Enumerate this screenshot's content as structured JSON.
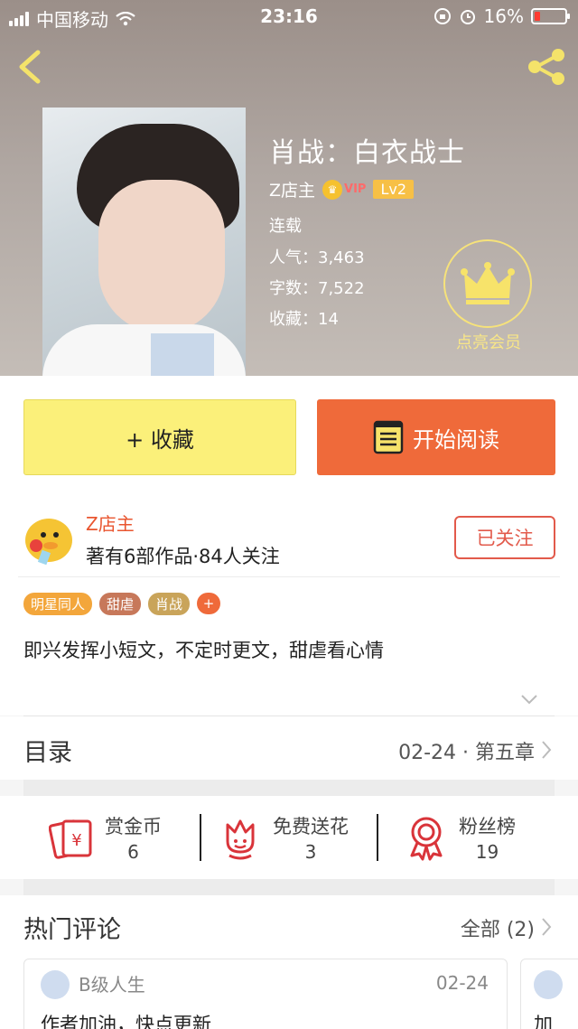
{
  "status_bar": {
    "carrier": "中国移动",
    "time": "23:16",
    "battery": "16%"
  },
  "book": {
    "title": "肖战：白衣战士",
    "author": "Z店主",
    "vip_label": "VIP",
    "level": "Lv2",
    "status": "连载",
    "popularity": "人气：3,463",
    "words": "字数：7,522",
    "favorites": "收藏：14",
    "vip_member_label": "点亮会员"
  },
  "actions": {
    "favorite_label": "+ 收藏",
    "read_label": "开始阅读"
  },
  "author_info": {
    "name": "Z店主",
    "stats": "著有6部作品·84人关注",
    "follow_label": "已关注"
  },
  "tags": [
    {
      "label": "明星同人",
      "color": "#f3a63b"
    },
    {
      "label": "甜虐",
      "color": "#c7785a"
    },
    {
      "label": "肖战",
      "color": "#c9a45a"
    }
  ],
  "tag_add": "+",
  "intro": "即兴发挥小短文，不定时更文，甜虐看心情",
  "toc": {
    "title": "目录",
    "latest": "02-24 · 第五章"
  },
  "rewards": [
    {
      "label": "赏金币",
      "count": "6"
    },
    {
      "label": "免费送花",
      "count": "3"
    },
    {
      "label": "粉丝榜",
      "count": "19"
    }
  ],
  "comments": {
    "title": "热门评论",
    "all_label": "全部 (2)",
    "items": [
      {
        "user": "B级人生",
        "date": "02-24",
        "text": "作者加油，快点更新"
      },
      {
        "text": "加"
      }
    ]
  },
  "colors": {
    "accent": "#ef6a3a",
    "favorite_bg": "#fbf07a",
    "author_red": "#e9552f"
  }
}
